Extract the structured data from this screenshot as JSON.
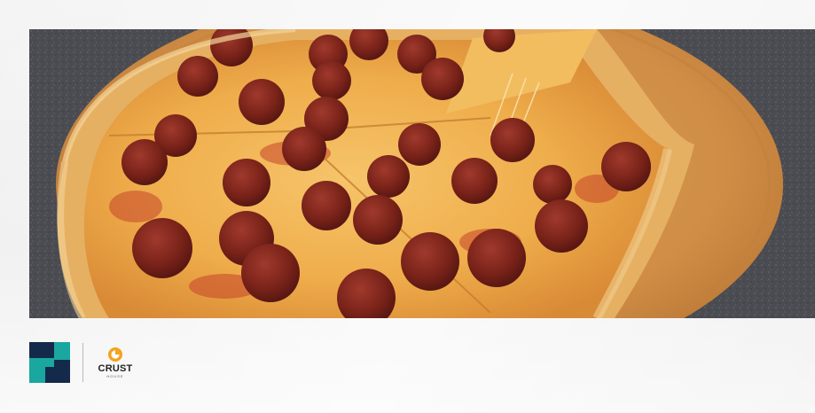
{
  "hero": {
    "image_description_icon": "pepperoni-pizza-photo"
  },
  "brand": {
    "partner_icon": "partner-logo-icon",
    "crust_name": "CRUST",
    "crust_sub": "HOUSE",
    "colors": {
      "partner_dark": "#142a4a",
      "partner_teal": "#1aa7a0",
      "crust_orange": "#f5a21c",
      "crust_text": "#222222"
    }
  }
}
